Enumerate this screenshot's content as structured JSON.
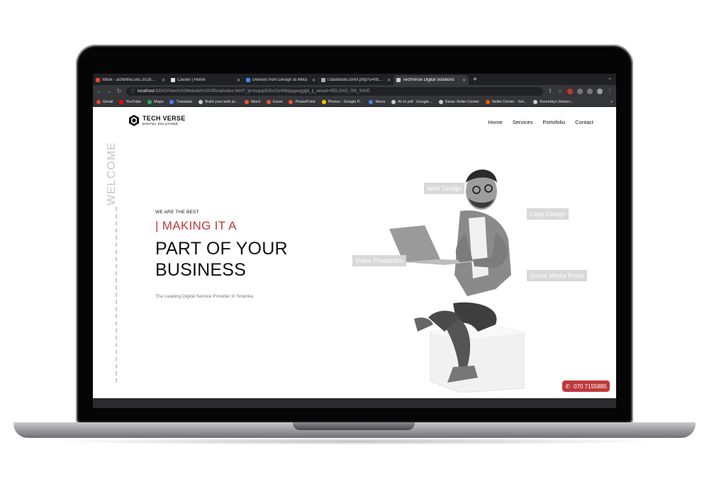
{
  "browser": {
    "tabs": [
      {
        "title": "Inbox - achintha.uns.2018@gm",
        "favicon": "gmail-icon",
        "color": "#ea4335"
      },
      {
        "title": "Cavani | Home",
        "favicon": "triangle-icon",
        "color": "#e0e0e0"
      },
      {
        "title": "Devices from Design at Meta",
        "favicon": "meta-icon",
        "color": "#4285f4"
      },
      {
        "title": "l.facebook.com/l.php?u=https%",
        "favicon": "globe-icon",
        "color": "#aaaaaa"
      },
      {
        "title": "TechVerse Digital Solutions",
        "favicon": "gear-icon",
        "color": "#cccccc"
      }
    ],
    "active_tab": 4,
    "url_host": "localhost",
    "url_rest": ":63342/New%20Website%20Official/index.html?_ijt=ioujup2h5s10v40kbjagavggij&_ij_reload=RELOAD_ON_SAVE",
    "bookmarks": [
      {
        "label": "Gmail",
        "color": "#ea4335"
      },
      {
        "label": "YouTube",
        "color": "#ff0000"
      },
      {
        "label": "Maps",
        "color": "#34a853"
      },
      {
        "label": "Translate",
        "color": "#4285f4"
      },
      {
        "label": "Build your web pr...",
        "color": "#cccccc"
      },
      {
        "label": "Word",
        "color": "#e8562a"
      },
      {
        "label": "Excel",
        "color": "#e8562a"
      },
      {
        "label": "PowerPoint",
        "color": "#e8562a"
      },
      {
        "label": "Photos - Google P...",
        "color": "#fbbc05"
      },
      {
        "label": "News",
        "color": "#4285f4"
      },
      {
        "label": "Al ict pdf - Google...",
        "color": "#cccccc"
      },
      {
        "label": "Daraz Seller Center",
        "color": "#cccccc"
      },
      {
        "label": "Seller Center - Sel...",
        "color": "#f85606"
      },
      {
        "label": "Koombiyo Deliver...",
        "color": "#cccccc"
      }
    ]
  },
  "site": {
    "brand": {
      "name": "TECH VERSE",
      "sub": "DIGITAL SOLUTIONS"
    },
    "nav": [
      "Home",
      "Services",
      "Portofolio",
      "Contact"
    ],
    "side_text": "WELCOME",
    "eyebrow": "WE ARE THE BEST",
    "accent_line": "| MAKING IT A",
    "headline_line1": "PART OF YOUR",
    "headline_line2": "BUSINESS",
    "tagline": "The Leading Digital Service Provider In Srilanka",
    "services": [
      "Web Design",
      "Logo Design",
      "Video Production",
      "Social Media Posts"
    ],
    "phone": "070 7155885",
    "accent_color": "#c0393b"
  }
}
